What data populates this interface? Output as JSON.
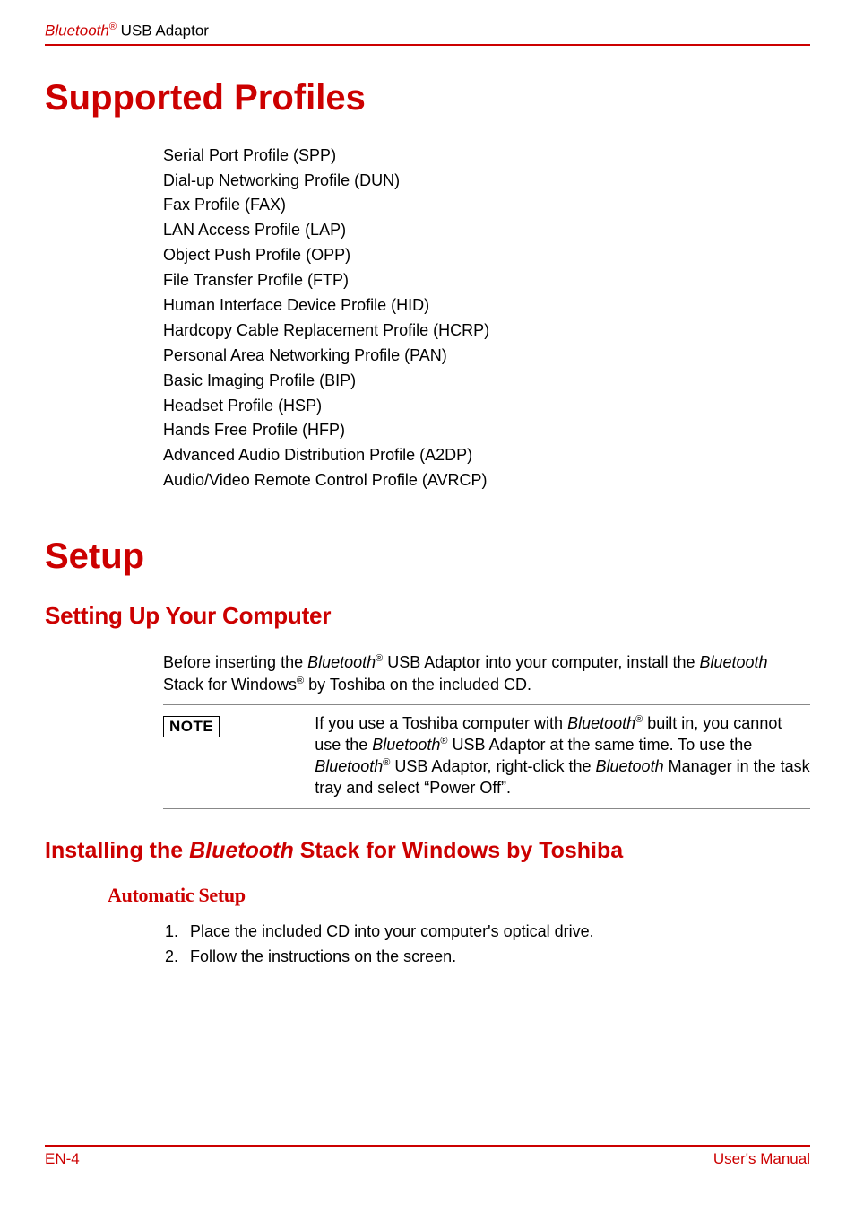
{
  "header": {
    "brand": "Bluetooth",
    "reg": "®",
    "product": " USB Adaptor"
  },
  "section1": {
    "title": "Supported Profiles",
    "profiles": [
      "Serial Port Profile (SPP)",
      "Dial-up Networking Profile (DUN)",
      "Fax Profile (FAX)",
      "LAN Access Profile (LAP)",
      "Object Push Profile (OPP)",
      "File Transfer Profile (FTP)",
      "Human Interface Device Profile (HID)",
      "Hardcopy Cable Replacement Profile (HCRP)",
      "Personal Area Networking Profile (PAN)",
      "Basic Imaging Profile (BIP)",
      "Headset Profile (HSP)",
      "Hands Free Profile (HFP)",
      "Advanced Audio Distribution Profile (A2DP)",
      "Audio/Video Remote Control Profile (AVRCP)"
    ]
  },
  "section2": {
    "title": "Setup",
    "sub1": {
      "heading": "Setting Up Your Computer",
      "para": {
        "p1": "Before inserting the ",
        "p2": "Bluetooth",
        "p3": "®",
        "p4": " USB Adaptor into your computer, install the ",
        "p5": "Bluetooth",
        "p6": " Stack for Windows",
        "p7": "®",
        "p8": " by Toshiba on the included CD."
      },
      "note_label": "NOTE",
      "note": {
        "n1": "If you use a Toshiba computer with ",
        "n2": "Bluetooth",
        "n3": "®",
        "n4": " built in, you cannot use the ",
        "n5": "Bluetooth",
        "n6": "®",
        "n7": " USB Adaptor at the same time. To use the ",
        "n8": "Bluetooth",
        "n9": "®",
        "n10": " USB Adaptor, right-click the ",
        "n11": "Bluetooth",
        "n12": " Manager in the task tray and select “Power Off”."
      }
    },
    "sub2": {
      "heading_p1": "Installing the ",
      "heading_p2": "Bluetooth",
      "heading_p3": " Stack for Windows by Toshiba",
      "topic": "Automatic Setup",
      "steps": [
        "Place the included CD into your computer's optical drive.",
        "Follow the instructions on the screen."
      ]
    }
  },
  "footer": {
    "left": "EN-4",
    "right": "User's Manual"
  }
}
